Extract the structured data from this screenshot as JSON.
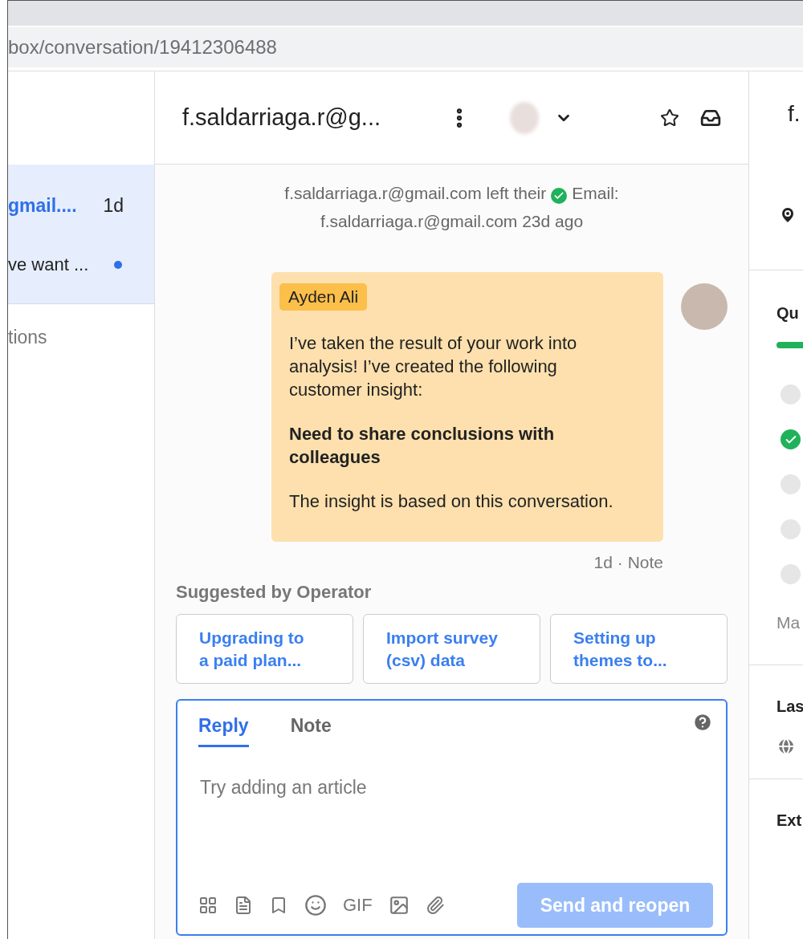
{
  "address_bar": {
    "url": "box/conversation/19412306488"
  },
  "inbox_list": {
    "conversation": {
      "sender": "gmail....",
      "time": "1d",
      "preview": "ve want ...",
      "selected": true,
      "unread": true
    },
    "section_label": "tions"
  },
  "conversation": {
    "title": "f.saldarriaga.r@g...",
    "event": {
      "before": "f.saldarriaga.r@gmail.com left their",
      "after": "Email: f.saldarriaga.r@gmail.com 23d ago"
    },
    "note": {
      "author": "Ayden Ali",
      "paragraphs": [
        {
          "text": "I’ve taken the result of your work into analysis! I’ve created the following customer insight:",
          "bold": false
        },
        {
          "text": "Need to share conclusions with colleagues",
          "bold": true
        },
        {
          "text": "The insight is based on this conversation.",
          "bold": false
        }
      ],
      "meta": "1d · Note"
    },
    "suggestions": {
      "label": "Suggested by Operator",
      "items": [
        "Upgrading to a paid plan...",
        "Import survey (csv) data",
        "Setting up themes to..."
      ]
    },
    "composer": {
      "tabs": [
        {
          "label": "Reply",
          "selected": true
        },
        {
          "label": "Note",
          "selected": false
        }
      ],
      "placeholder": "Try adding an article",
      "gif": "GIF",
      "send": {
        "label": "Send and reopen",
        "disabled": true
      }
    }
  },
  "details": {
    "name": "f.",
    "section_1": "Qu",
    "progress": {
      "level": 1
    },
    "checklist": [
      {
        "checked": false
      },
      {
        "checked": true
      },
      {
        "checked": false
      },
      {
        "checked": false
      },
      {
        "checked": false
      }
    ],
    "more": "Ma",
    "section_2": "Las",
    "section_3": "Ext"
  }
}
